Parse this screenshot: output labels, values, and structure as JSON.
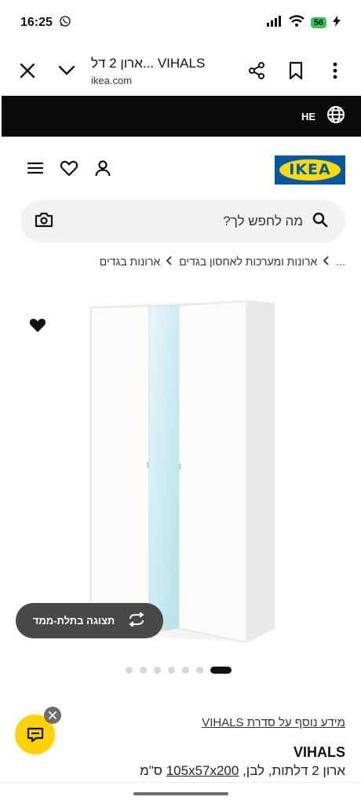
{
  "status_bar": {
    "time": "16:25",
    "battery": "56"
  },
  "browser": {
    "title": "ארון 2 דל... VIHALS",
    "host": "ikea.com"
  },
  "lang_strip": {
    "language_code": "HE"
  },
  "brand": {
    "logo_text": "IKEA",
    "logo_blue": "#0058a3",
    "logo_yellow": "#ffdb00"
  },
  "search": {
    "placeholder": "מה לחפש לך?"
  },
  "breadcrumb": {
    "items": [
      "...",
      "ארונות ומערכות לאחסון בגדים",
      "ארונות בגדים"
    ]
  },
  "gallery": {
    "view_3d_label": "תצוגה בתלת-ממד",
    "dot_count": 7,
    "active_dot": 7
  },
  "product": {
    "series_link": "מידע נוסף על סדרת VIHALS",
    "name": "VIHALS",
    "description_prefix": "ארון 2 דלתות, לבן,",
    "size": "105x57x200",
    "unit": "ס\"מ"
  },
  "colors": {
    "chat_button": "#ffd200",
    "view_3d_bg": "#484848"
  }
}
